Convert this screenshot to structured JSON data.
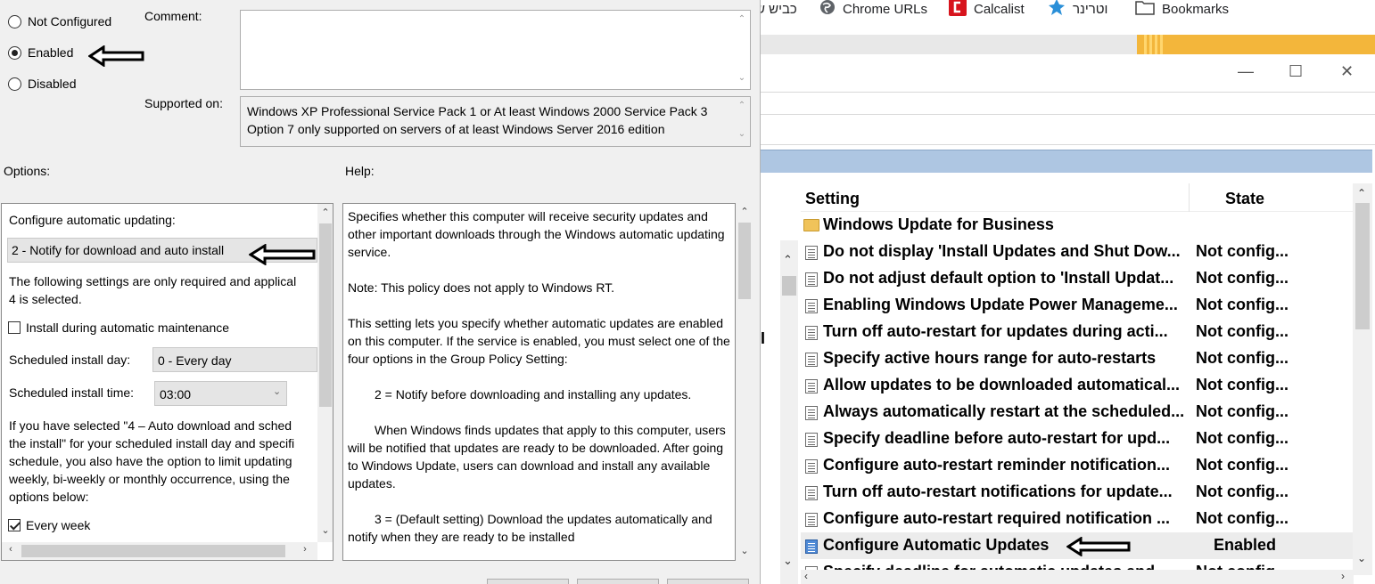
{
  "dialog": {
    "radios": [
      {
        "label": "Not Configured",
        "selected": false
      },
      {
        "label": "Enabled",
        "selected": true
      },
      {
        "label": "Disabled",
        "selected": false
      }
    ],
    "comment_label": "Comment:",
    "comment_value": "",
    "supported_label": "Supported on:",
    "supported_lines": [
      "Windows XP Professional Service Pack 1 or At least Windows 2000 Service Pack 3",
      "Option 7 only supported on servers of at least Windows Server 2016 edition"
    ],
    "options_label": "Options:",
    "help_label": "Help:"
  },
  "options": {
    "configure_label": "Configure automatic updating:",
    "configure_value": "2 - Notify for download and auto install",
    "note_lines": [
      "The following settings are only required and applical",
      "4 is selected."
    ],
    "maintenance_label": "Install during automatic maintenance",
    "maintenance_checked": false,
    "install_day_label": "Scheduled install day:",
    "install_day_value": "0 - Every day",
    "install_time_label": "Scheduled install time:",
    "install_time_value": "03:00",
    "info_lines": [
      "If you have selected \"4 – Auto download and sched",
      "the install\" for your scheduled install day and specifi",
      "schedule, you also have the option to limit updating",
      "weekly, bi-weekly or monthly occurrence, using the",
      "options below:"
    ],
    "every_week_label": "Every week",
    "every_week_checked": true
  },
  "help": {
    "paragraphs": [
      {
        "text": "Specifies whether this computer will receive security updates and other important downloads through the Windows automatic updating service.",
        "indent": false
      },
      {
        "text": "Note: This policy does not apply to Windows RT.",
        "indent": false
      },
      {
        "text": "This setting lets you specify whether automatic updates are enabled on this computer. If the service is enabled, you must select one of the four options in the Group Policy Setting:",
        "indent": false
      },
      {
        "text": "2 = Notify before downloading and installing any updates.",
        "indent": true
      },
      {
        "text": "When Windows finds updates that apply to this computer, users will be notified that updates are ready to be downloaded. After going to Windows Update, users can download and install any available updates.",
        "indent": true
      },
      {
        "text": "3 = (Default setting) Download the updates automatically and notify when they are ready to be installed",
        "indent": true
      }
    ]
  },
  "browser": {
    "bookmarks": [
      {
        "label": "כביש ש",
        "icon": "cut-bookmark"
      },
      {
        "label": "Chrome URLs",
        "icon": "globe-icon"
      },
      {
        "label": "Calcalist",
        "icon": "calcalist-icon"
      },
      {
        "label": "וטרינר",
        "icon": "star-icon"
      },
      {
        "label": "Bookmarks",
        "icon": "folder-icon"
      }
    ],
    "window_controls": {
      "minimize": "—",
      "maximize": "☐",
      "close": "✕"
    }
  },
  "policy_list": {
    "columns": {
      "setting": "Setting",
      "state": "State"
    },
    "rows": [
      {
        "name": "Windows Update for Business",
        "state": "",
        "type": "folder"
      },
      {
        "name": "Do not display 'Install Updates and Shut Dow...",
        "state": "Not config...",
        "type": "policy"
      },
      {
        "name": "Do not adjust default option to 'Install Updat...",
        "state": "Not config...",
        "type": "policy"
      },
      {
        "name": "Enabling Windows Update Power Manageme...",
        "state": "Not config...",
        "type": "policy"
      },
      {
        "name": "Turn off auto-restart for updates during acti...",
        "state": "Not config...",
        "type": "policy"
      },
      {
        "name": "Specify active hours range for auto-restarts",
        "state": "Not config...",
        "type": "policy"
      },
      {
        "name": "Allow updates to be downloaded automatical...",
        "state": "Not config...",
        "type": "policy"
      },
      {
        "name": "Always automatically restart at the scheduled...",
        "state": "Not config...",
        "type": "policy"
      },
      {
        "name": "Specify deadline before auto-restart for upd...",
        "state": "Not config...",
        "type": "policy"
      },
      {
        "name": "Configure auto-restart reminder notification...",
        "state": "Not config...",
        "type": "policy"
      },
      {
        "name": "Turn off auto-restart notifications for update...",
        "state": "Not config...",
        "type": "policy"
      },
      {
        "name": "Configure auto-restart required notification ...",
        "state": "Not config...",
        "type": "policy"
      },
      {
        "name": "Configure Automatic Updates",
        "state": "Enabled",
        "type": "policy-selected"
      },
      {
        "name": "Specify deadline for automatic updates and ...",
        "state": "Not config...",
        "type": "policy"
      }
    ]
  },
  "colors": {
    "dialog_bg": "#f0f0f0",
    "progress_accent": "#f3b63b",
    "tree_band": "#aec6e2",
    "selected_row": "#ececec",
    "calcalist_red": "#d7141d"
  }
}
